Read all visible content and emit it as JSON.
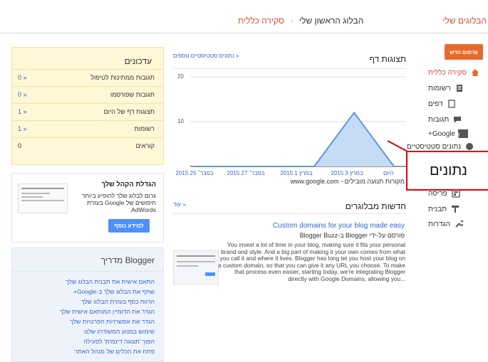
{
  "topbar": {
    "brand": "הבלוגים שלי",
    "blog_name": "הבלוג הראשון שלי",
    "separator": "·",
    "section": "סקירה כללית"
  },
  "nav": {
    "new_post": "פרסום חדש",
    "items": [
      {
        "label": "סקירה כללית",
        "icon": "home-icon",
        "active": true
      },
      {
        "label": "רשומות",
        "icon": "posts-icon"
      },
      {
        "label": "דפים",
        "icon": "pages-icon"
      },
      {
        "label": "תגובות",
        "icon": "comments-icon"
      },
      {
        "label": "Google+",
        "icon": "google-plus-icon"
      },
      {
        "label": "נתונים סטטיסטיים",
        "icon": "stats-icon"
      },
      {
        "label": "פריסה",
        "icon": "layout-icon"
      },
      {
        "label": "תבנית",
        "icon": "template-icon"
      },
      {
        "label": "הגדרות",
        "icon": "settings-icon"
      }
    ]
  },
  "pageviews": {
    "title": "תצוגות דף",
    "more_link": "נתונים סטטיסטיים נוספים »",
    "source": "מקורות תנועה מובילים - www.google.com"
  },
  "chart_data": {
    "type": "area",
    "x": [
      "2015 בפבר׳ 25",
      "2015 בפבר׳ 27",
      "2015 במרץ 1",
      "2015 במרץ 3",
      "היום"
    ],
    "series": [
      {
        "values": [
          0,
          0,
          0,
          0,
          12,
          0
        ]
      }
    ],
    "yticks": [
      "20",
      "10"
    ],
    "ylim": [
      0,
      20
    ]
  },
  "news": {
    "title": "חדשות מבלוגרים",
    "more": "עוד »",
    "post_title": "Custom domains for your blog made easy",
    "byline": "פורסם על-ידי Blogger ב-Blogger Buzz",
    "body": "You invest a lot of time in your blog, making sure it fits your personal brand and style. And a big part of making it your own comes from what you call it and where it lives. Blogger has long let you host your blog on a custom domain, so that you can give it any URL you choose. To make that process even easier, starting today, we're integrating Blogger directly with Google Domains, allowing you..."
  },
  "updates": {
    "title": "עדכונים",
    "rows": [
      {
        "label": "תגובות ממתינות לטיפול",
        "value": "0 »"
      },
      {
        "label": "תגובות שפורסמו",
        "value": "0 »"
      },
      {
        "label": "תצוגות דף של היום",
        "value": "1 »"
      },
      {
        "label": "רשומות",
        "value": "1 »"
      },
      {
        "label": "קוראים",
        "value": "0"
      }
    ]
  },
  "audience": {
    "title": "הגדלת הקהל שלך",
    "text": "גרום לבלוג שלך להופיע ביותר חיפושים של Google בעזרת AdWords.",
    "button": "למידע נוסף"
  },
  "guide": {
    "title": "מדריך Blogger",
    "links": [
      "התאם אישית את תבנית הבלוג שלך",
      "שתף את הבלוג שלך ב-Google+",
      "הרווח כסף בעזרת הבלוג שלך",
      "הגדר את הדומיין המותאם אישית שלך",
      "הגדר את אפשרויות הפרטיות שלך",
      "שימוש במנוע המשודרג שלנו",
      "הפוך 'תצוגה דינמית' לפעילה",
      "פתח את הכלים של מנהל האתר"
    ]
  },
  "callout": {
    "label": "נתונים"
  }
}
